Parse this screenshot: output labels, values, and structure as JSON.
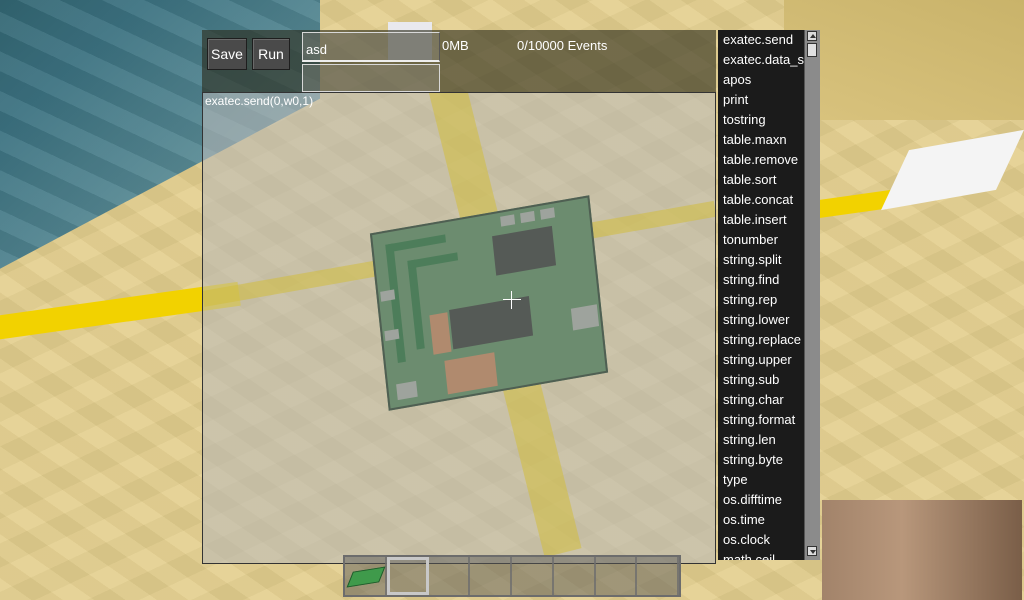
{
  "toolbar": {
    "save_label": "Save",
    "run_label": "Run",
    "name_value": "asd",
    "memory": "0MB",
    "events": "0/10000 Events"
  },
  "editor": {
    "code": "exatec.send(0,w0,1)"
  },
  "autocomplete": {
    "items": [
      "exatec.send",
      "exatec.data_s",
      "apos",
      "print",
      "tostring",
      "table.maxn",
      "table.remove",
      "table.sort",
      "table.concat",
      "table.insert",
      "tonumber",
      "string.split",
      "string.find",
      "string.rep",
      "string.lower",
      "string.replace",
      "string.upper",
      "string.sub",
      "string.char",
      "string.format",
      "string.len",
      "string.byte",
      "type",
      "os.difftime",
      "os.time",
      "os.clock",
      "math.ceil"
    ]
  },
  "hotbar": {
    "slot_count": 8,
    "selected_slot": 1,
    "slot_items": [
      "circuit-board-icon",
      "",
      "",
      "",
      "",
      "",
      "",
      ""
    ]
  },
  "colors": {
    "rail_yellow": "#f2d200",
    "panel_dark": "#1b1b1b",
    "button_bg": "#4a4a4a",
    "text_white": "#ffffff"
  }
}
